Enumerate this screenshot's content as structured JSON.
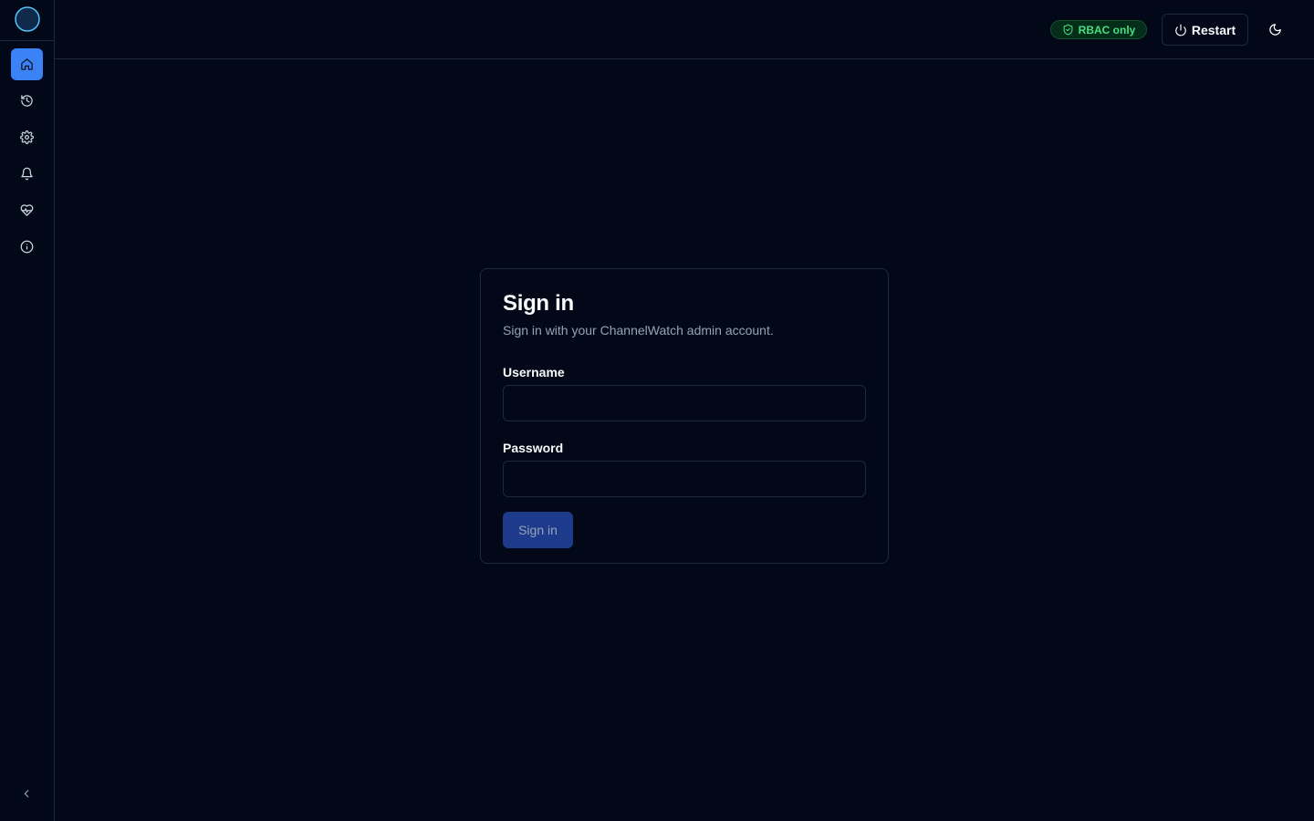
{
  "app": {
    "logo_icon": "moon-globe-logo"
  },
  "sidebar": {
    "items": [
      {
        "id": "home",
        "icon": "home-icon",
        "active": true
      },
      {
        "id": "history",
        "icon": "history-icon",
        "active": false
      },
      {
        "id": "settings",
        "icon": "gear-icon",
        "active": false
      },
      {
        "id": "notifications",
        "icon": "bell-icon",
        "active": false
      },
      {
        "id": "health",
        "icon": "heart-pulse-icon",
        "active": false
      },
      {
        "id": "about",
        "icon": "info-icon",
        "active": false
      }
    ],
    "collapse_icon": "chevron-left-icon"
  },
  "header": {
    "badge_label": "RBAC only",
    "badge_icon": "shield-check-icon",
    "restart_label": "Restart",
    "restart_icon": "power-icon",
    "theme_icon": "moon-icon"
  },
  "login": {
    "title": "Sign in",
    "subtitle": "Sign in with your ChannelWatch admin account.",
    "username_label": "Username",
    "username_value": "",
    "password_label": "Password",
    "password_value": "",
    "submit_label": "Sign in"
  },
  "colors": {
    "background": "#020817",
    "accent": "#3b82f6",
    "border": "#1e293b",
    "badge_green": "#4ade80",
    "submit_bg": "#1e3a8a"
  }
}
